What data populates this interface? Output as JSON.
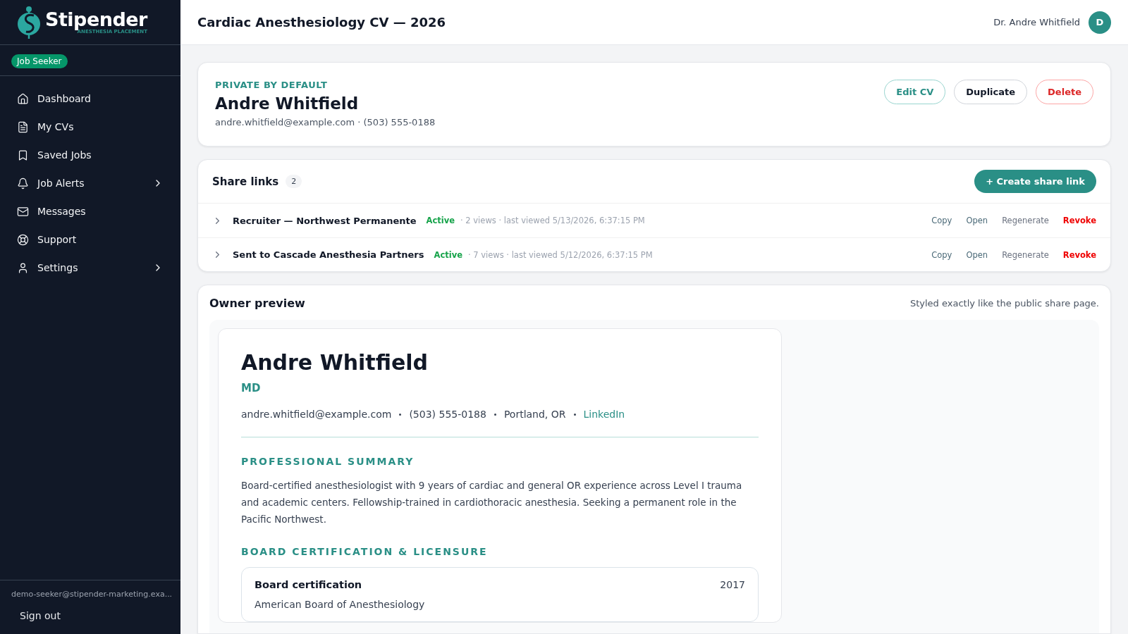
{
  "brand": {
    "name": "Stipender",
    "tagline": "ANESTHESIA PLACEMENT"
  },
  "role_badge": "Job Seeker",
  "sidebar": {
    "items": [
      {
        "label": "Dashboard",
        "has_submenu": false
      },
      {
        "label": "My CVs",
        "has_submenu": false
      },
      {
        "label": "Saved Jobs",
        "has_submenu": false
      },
      {
        "label": "Job Alerts",
        "has_submenu": true
      },
      {
        "label": "Messages",
        "has_submenu": false
      },
      {
        "label": "Support",
        "has_submenu": false
      },
      {
        "label": "Settings",
        "has_submenu": true
      }
    ],
    "account_email": "demo-seeker@stipender-marketing.exa...",
    "sign_out": "Sign out"
  },
  "header": {
    "title": "Cardiac Anesthesiology CV — 2026",
    "user_name": "Dr. Andre Whitfield",
    "avatar_initial": "D"
  },
  "cv_card": {
    "visibility": "PRIVATE BY DEFAULT",
    "name": "Andre Whitfield",
    "contact": "andre.whitfield@example.com · (503) 555-0188",
    "actions": [
      {
        "label": "Edit CV",
        "kind": "primary"
      },
      {
        "label": "Duplicate",
        "kind": "neutral"
      },
      {
        "label": "Delete",
        "kind": "danger"
      }
    ]
  },
  "share_links": {
    "title": "Share links",
    "count": "2",
    "create_button": "+ Create share link",
    "rows": [
      {
        "name": "Recruiter — Northwest Permanente",
        "status": "Active",
        "meta": "· 2 views · last viewed 5/13/2026, 6:37:15 PM",
        "expanded": false,
        "actions": [
          {
            "label": "Copy",
            "kind": "link"
          },
          {
            "label": "Open",
            "kind": "link"
          },
          {
            "label": "Regenerate",
            "kind": "muted"
          },
          {
            "label": "Revoke",
            "kind": "danger"
          }
        ]
      },
      {
        "name": "Sent to Cascade Anesthesia Partners",
        "status": "Active",
        "meta": "· 7 views · last viewed 5/12/2026, 6:37:15 PM",
        "expanded": false,
        "actions": [
          {
            "label": "Copy",
            "kind": "link"
          },
          {
            "label": "Open",
            "kind": "link"
          },
          {
            "label": "Regenerate",
            "kind": "muted"
          },
          {
            "label": "Revoke",
            "kind": "danger"
          }
        ]
      }
    ]
  },
  "preview": {
    "title": "Owner preview",
    "note": "Styled exactly like the public share page.",
    "cv": {
      "name": "Andre Whitfield",
      "credential": "MD",
      "contact": [
        {
          "text": "andre.whitfield@example.com",
          "kind": "text"
        },
        {
          "text": "(503) 555-0188",
          "kind": "text"
        },
        {
          "text": "Portland, OR",
          "kind": "text"
        },
        {
          "text": "LinkedIn",
          "kind": "link"
        }
      ],
      "sections": [
        {
          "heading": "PROFESSIONAL SUMMARY",
          "body": "Board-certified anesthesiologist with 9 years of cardiac and general OR experience across Level I trauma and academic centers. Fellowship-trained in cardiothoracic anesthesia. Seeking a permanent role in the Pacific Northwest."
        },
        {
          "heading": "BOARD CERTIFICATION & LICENSURE",
          "entries": [
            {
              "title": "Board certification",
              "year": "2017",
              "subtitle": "American Board of Anesthesiology"
            }
          ]
        }
      ]
    }
  }
}
